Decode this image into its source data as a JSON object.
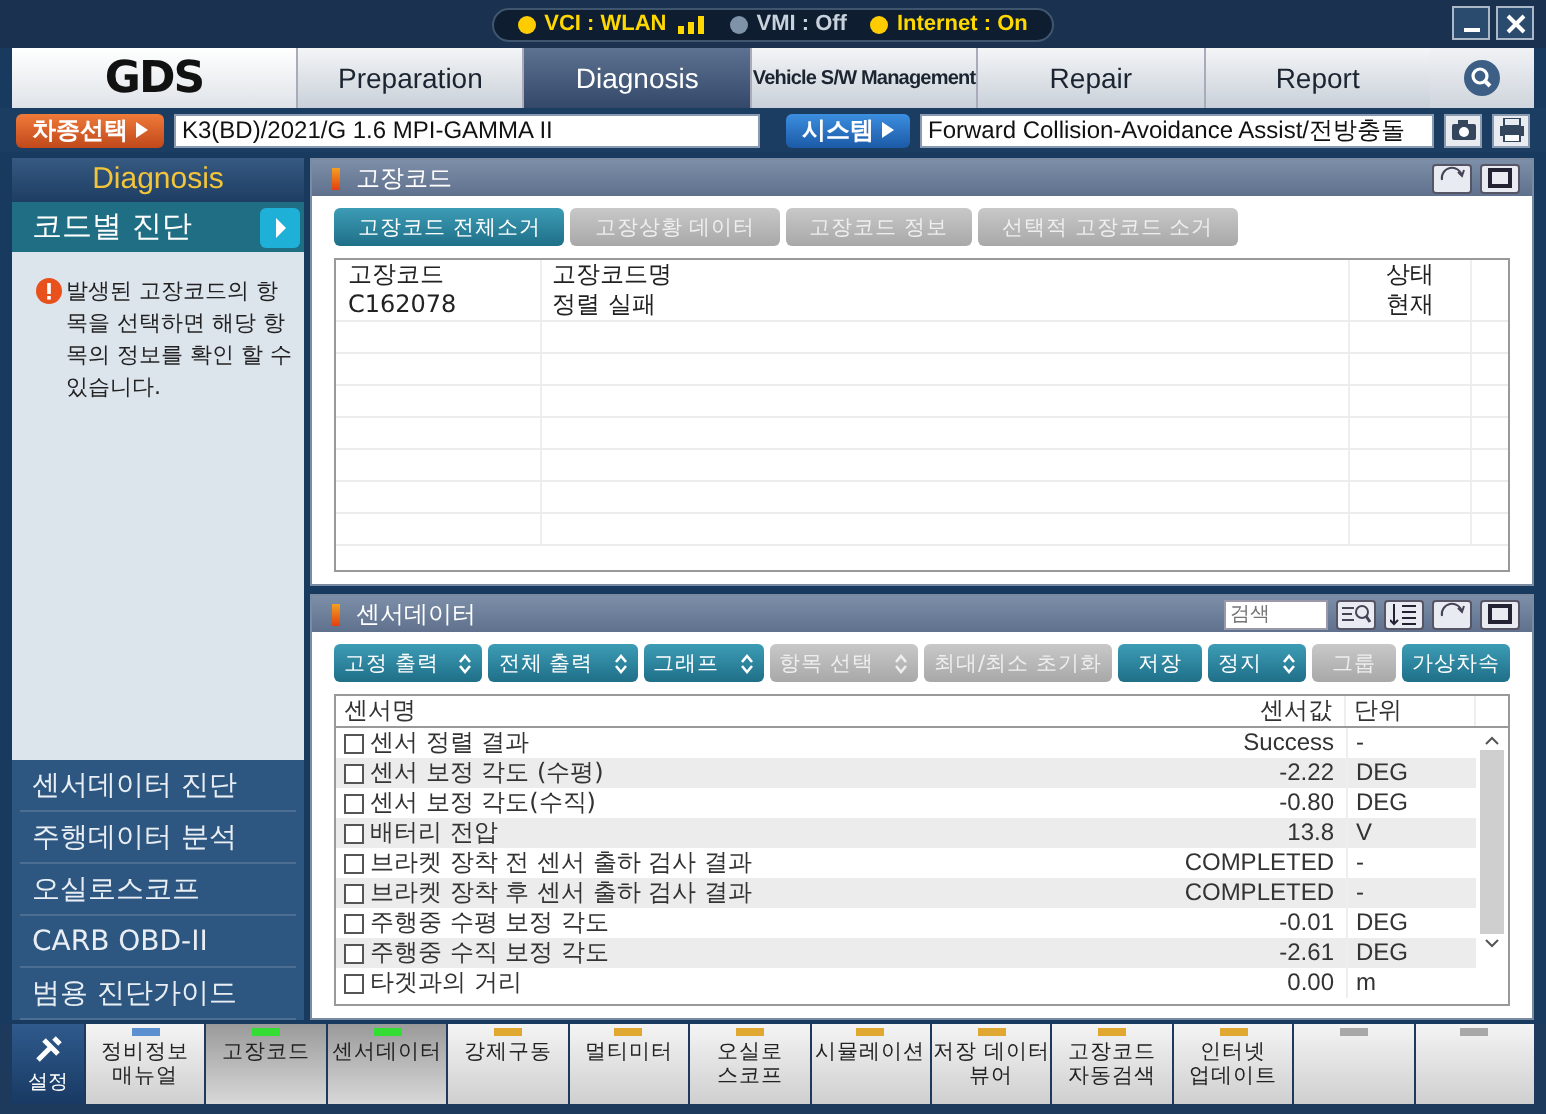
{
  "status_bar": {
    "items": [
      {
        "label": "VCI : WLAN",
        "color": "#ffcc00",
        "signal": true
      },
      {
        "label": "VMI : Off",
        "color": "#7f93a8",
        "signal": false
      },
      {
        "label": "Internet : On",
        "color": "#ffcc00",
        "signal": false
      }
    ]
  },
  "logo": "GDS",
  "tabs": [
    {
      "label": "Preparation",
      "selected": false
    },
    {
      "label": "Diagnosis",
      "selected": true
    },
    {
      "label": "Vehicle S/W Management",
      "selected": false
    },
    {
      "label": "Repair",
      "selected": false
    },
    {
      "label": "Report",
      "selected": false
    }
  ],
  "vehicle_bar": {
    "vehicle_button": "차종선택",
    "vehicle": "K3(BD)/2021/G 1.6 MPI-GAMMA II",
    "system_button": "시스템",
    "system": "Forward Collision-Avoidance Assist/전방충돌"
  },
  "sidebar": {
    "title": "Diagnosis",
    "current": "코드별 진단",
    "note": "발생된 고장코드의 항목을 선택하면 해당 항목의 정보를 확인 할 수 있습니다.",
    "items": [
      "센서데이터 진단",
      "주행데이터 분석",
      "오실로스코프",
      "CARB OBD-II",
      "범용 진단가이드"
    ]
  },
  "dtc_panel": {
    "title": "고장코드",
    "buttons": [
      {
        "label": "고장코드 전체소거",
        "disabled": false
      },
      {
        "label": "고장상황 데이터",
        "disabled": true
      },
      {
        "label": "고장코드 정보",
        "disabled": true
      },
      {
        "label": "선택적 고장코드 소거",
        "disabled": true
      }
    ],
    "columns": [
      "고장코드",
      "고장코드명",
      "상태"
    ],
    "rows": [
      {
        "code": "C162078",
        "name": "정렬 실패",
        "status": "현재"
      }
    ]
  },
  "sensor_panel": {
    "title": "센서데이터",
    "search": {
      "placeholder": "검색"
    },
    "buttons": [
      {
        "label": "고정 출력",
        "dropdown": true,
        "disabled": false
      },
      {
        "label": "전체 출력",
        "dropdown": true,
        "disabled": false
      },
      {
        "label": "그래프",
        "dropdown": true,
        "disabled": false
      },
      {
        "label": "항목 선택",
        "dropdown": true,
        "disabled": true
      },
      {
        "label": "최대/최소 초기화",
        "dropdown": false,
        "disabled": true
      },
      {
        "label": "저장",
        "dropdown": false,
        "disabled": false
      },
      {
        "label": "정지",
        "dropdown": true,
        "disabled": false
      },
      {
        "label": "그룹",
        "dropdown": false,
        "disabled": true
      },
      {
        "label": "가상차속",
        "dropdown": false,
        "disabled": false
      }
    ],
    "columns": [
      "센서명",
      "센서값",
      "단위"
    ],
    "rows": [
      {
        "name": "센서 정렬 결과",
        "value": "Success",
        "unit": "-",
        "checked": false
      },
      {
        "name": "센서 보정 각도 (수평)",
        "value": "-2.22",
        "unit": "DEG",
        "checked": false
      },
      {
        "name": "센서 보정 각도(수직)",
        "value": "-0.80",
        "unit": "DEG",
        "checked": false
      },
      {
        "name": "배터리 전압",
        "value": "13.8",
        "unit": "V",
        "checked": false
      },
      {
        "name": "브라켓 장착 전 센서 출하 검사 결과",
        "value": "COMPLETED",
        "unit": "-",
        "checked": false
      },
      {
        "name": "브라켓 장착 후 센서 출하 검사 결과",
        "value": "COMPLETED",
        "unit": "-",
        "checked": false
      },
      {
        "name": "주행중 수평 보정 각도",
        "value": "-0.01",
        "unit": "DEG",
        "checked": false
      },
      {
        "name": "주행중 수직 보정 각도",
        "value": "-2.61",
        "unit": "DEG",
        "checked": false
      },
      {
        "name": "타겟과의 거리",
        "value": "0.00",
        "unit": "m",
        "checked": false
      }
    ]
  },
  "toolbar": {
    "settings": "설정",
    "buttons": [
      {
        "label": "정비정보\n매뉴얼",
        "color": "#5b8fd0",
        "selected": false
      },
      {
        "label": "고장코드",
        "color": "#33dd33",
        "selected": true
      },
      {
        "label": "센서데이터",
        "color": "#33dd33",
        "selected": true
      },
      {
        "label": "강제구동",
        "color": "#e0a830",
        "selected": false
      },
      {
        "label": "멀티미터",
        "color": "#e0a830",
        "selected": false
      },
      {
        "label": "오실로\n스코프",
        "color": "#e0a830",
        "selected": false
      },
      {
        "label": "시뮬레이션",
        "color": "#e0a830",
        "selected": false
      },
      {
        "label": "저장 데이터\n뷰어",
        "color": "#e0a830",
        "selected": false
      },
      {
        "label": "고장코드\n자동검색",
        "color": "#e0a830",
        "selected": false
      },
      {
        "label": "인터넷\n업데이트",
        "color": "#e0a830",
        "selected": false
      },
      {
        "color": "#a8a8a8",
        "selected": false
      },
      {
        "color": "#a8a8a8",
        "selected": false
      }
    ]
  }
}
